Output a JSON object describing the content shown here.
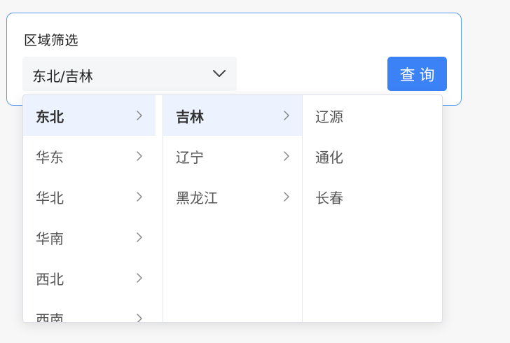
{
  "filter": {
    "title": "区域筛选",
    "selected_value": "东北/吉林",
    "query_button_label": "查询"
  },
  "cascader": {
    "regions": [
      {
        "label": "东北",
        "active": true
      },
      {
        "label": "华东",
        "active": false
      },
      {
        "label": "华北",
        "active": false
      },
      {
        "label": "华南",
        "active": false
      },
      {
        "label": "西北",
        "active": false
      },
      {
        "label": "西南",
        "active": false
      }
    ],
    "provinces": [
      {
        "label": "吉林",
        "active": true
      },
      {
        "label": "辽宁",
        "active": false
      },
      {
        "label": "黑龙江",
        "active": false
      }
    ],
    "cities": [
      {
        "label": "辽源"
      },
      {
        "label": "通化"
      },
      {
        "label": "长春"
      }
    ]
  },
  "colors": {
    "accent": "#3b82f6",
    "active_bg": "#ecf2fe",
    "card_border": "#5b9cf0"
  },
  "icons": {
    "select": "chevron-down-icon",
    "submenu": "chevron-right-icon"
  }
}
